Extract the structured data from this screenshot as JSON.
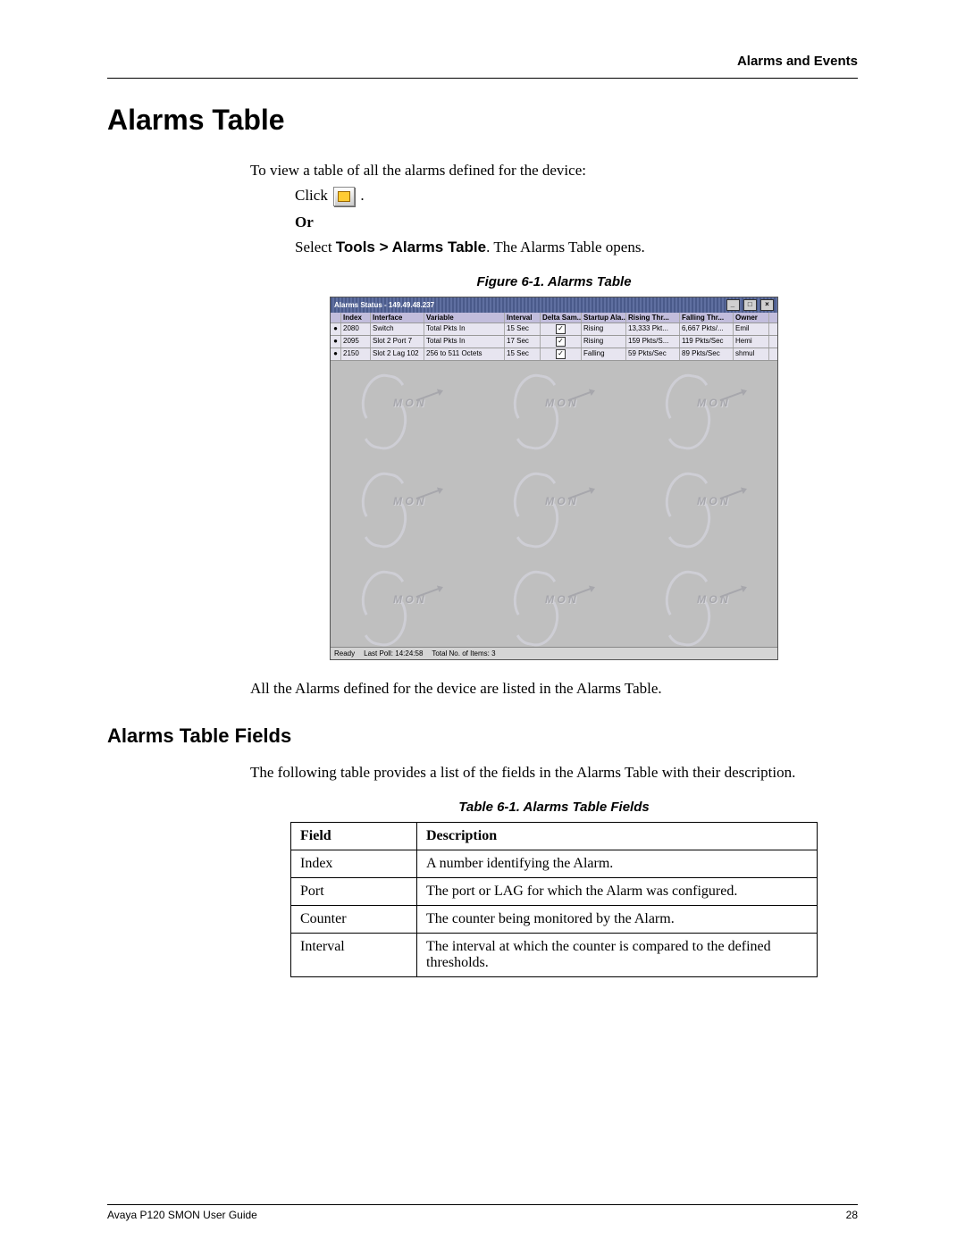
{
  "header": {
    "section": "Alarms and Events"
  },
  "title": "Alarms Table",
  "intro": "To view a table of all the alarms defined for the device:",
  "steps": {
    "click_label": "Click",
    "click_suffix": ".",
    "or": "Or",
    "select_prefix": "Select ",
    "select_menu": "Tools > Alarms Table",
    "select_suffix": ". The Alarms Table opens."
  },
  "figure_caption": "Figure 6-1.  Alarms Table",
  "app": {
    "title": "Alarms Status - 149.49.48.237",
    "headers": [
      "",
      "Index",
      "Interface",
      "Variable",
      "Interval",
      "Delta Sam...",
      "Startup Ala...",
      "Rising Thr...",
      "Falling Thr...",
      "Owner"
    ],
    "rows": [
      {
        "dot": "●",
        "index": "2080",
        "iface": "Switch",
        "var": "Total Pkts In",
        "intv": "15 Sec",
        "delta": "✓",
        "startup": "Rising",
        "rise": "13,333 Pkt...",
        "fall": "6,667 Pkts/...",
        "owner": "Emil"
      },
      {
        "dot": "●",
        "index": "2095",
        "iface": "Slot 2 Port 7",
        "var": "Total Pkts In",
        "intv": "17 Sec",
        "delta": "✓",
        "startup": "Rising",
        "rise": "159 Pkts/S...",
        "fall": "119 Pkts/Sec",
        "owner": "Hemi"
      },
      {
        "dot": "●",
        "index": "2150",
        "iface": "Slot 2 Lag 102",
        "var": "256 to 511 Octets",
        "intv": "15 Sec",
        "delta": "✓",
        "startup": "Falling",
        "rise": "59 Pkts/Sec",
        "fall": "89 Pkts/Sec",
        "owner": "shmul"
      }
    ],
    "status": {
      "ready": "Ready",
      "lastpoll": "Last Poll: 14:24:58",
      "total": "Total No. of Items: 3"
    }
  },
  "after_figure": "All the Alarms defined for the device are listed in the Alarms Table.",
  "subheading": "Alarms Table Fields",
  "table_intro": "The following table provides a list of the fields in the Alarms Table with their description.",
  "table_caption": "Table 6-1.  Alarms Table Fields",
  "fields_table": {
    "headers": [
      "Field",
      "Description"
    ],
    "rows": [
      [
        "Index",
        "A number identifying the Alarm."
      ],
      [
        "Port",
        "The port or LAG for which the Alarm was configured."
      ],
      [
        "Counter",
        "The counter being monitored by the Alarm."
      ],
      [
        "Interval",
        "The interval at which the counter is compared to the defined thresholds."
      ]
    ]
  },
  "footer": {
    "left": "Avaya P120 SMON User Guide",
    "right": "28"
  }
}
